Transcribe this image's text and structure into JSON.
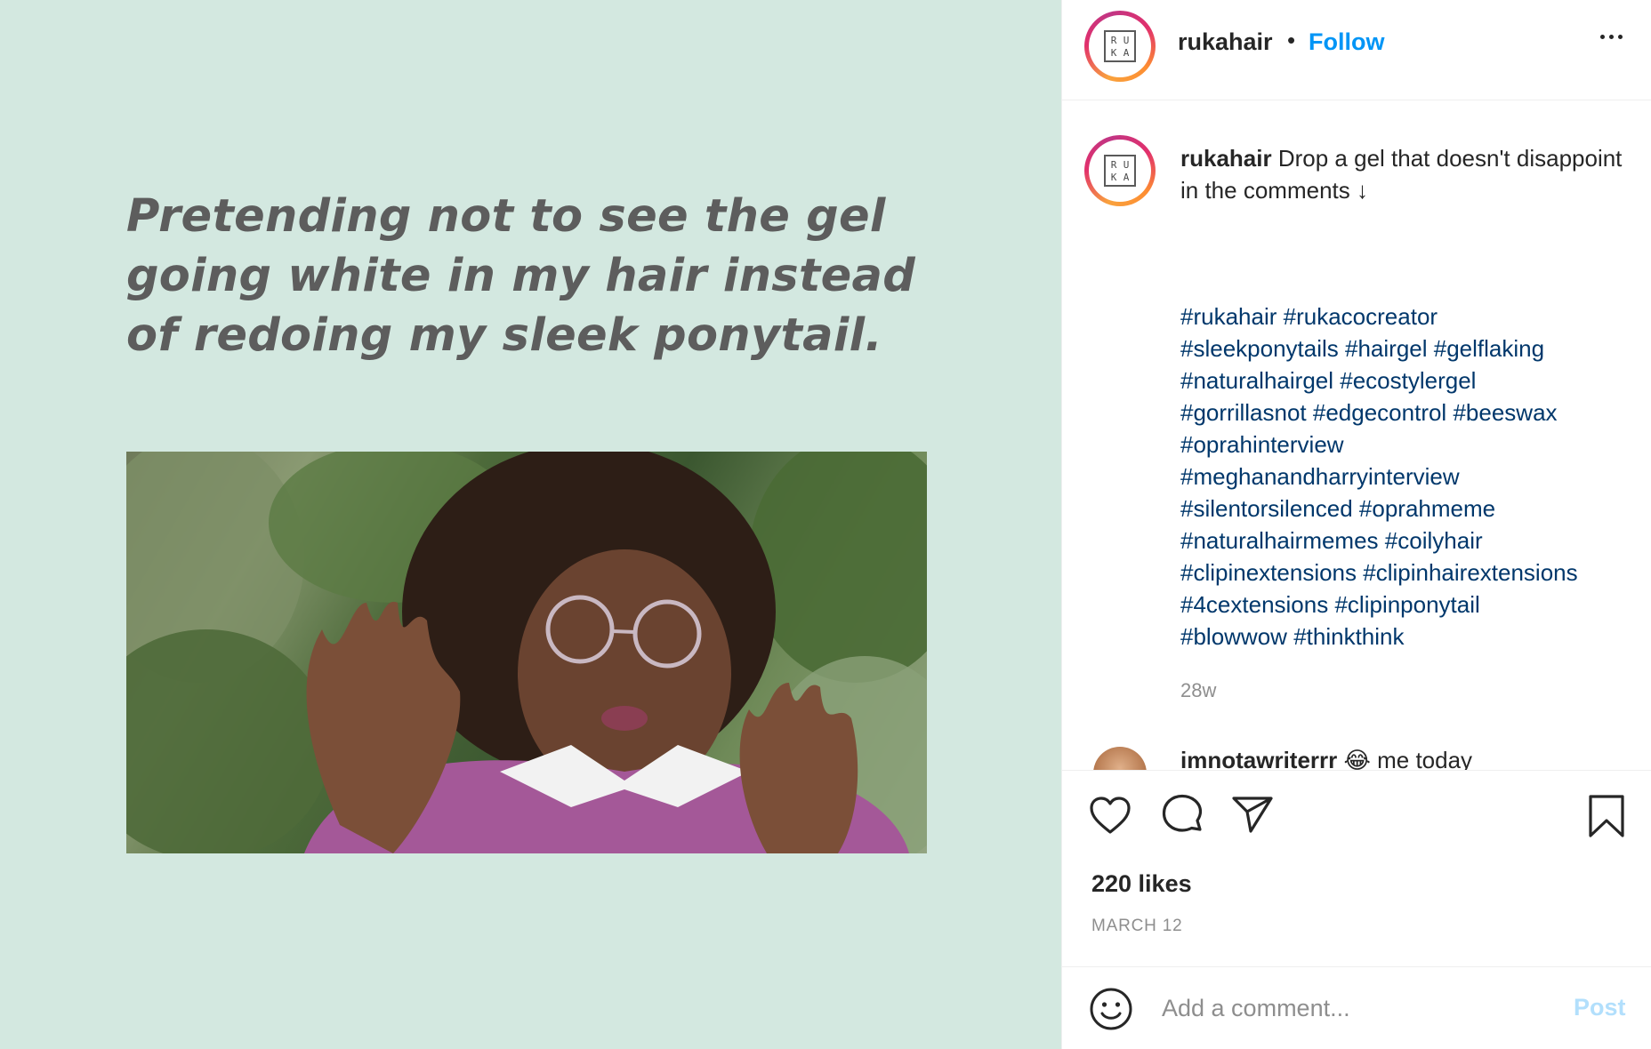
{
  "post": {
    "meme_text": "Pretending not to see the gel going white in my hair instead of redoing my sleek ponytail.",
    "media_bg": "#d3e8e0"
  },
  "header": {
    "username": "rukahair",
    "separator": "•",
    "follow_label": "Follow",
    "more_icon": "more-horizontal-icon"
  },
  "logo": {
    "letters": [
      "R",
      "U",
      "K",
      "A"
    ]
  },
  "caption": {
    "username": "rukahair",
    "text": "Drop a gel that doesn't disappoint in the comments ↓",
    "hashtags": [
      "#rukahair",
      "#rukacocreator",
      "#sleekponytails",
      "#hairgel",
      "#gelflaking",
      "#naturalhairgel",
      "#ecostylergel",
      "#gorrillasnot",
      "#edgecontrol",
      "#beeswax",
      "#oprahinterview",
      "#meghanandharryinterview",
      "#silentorsilenced",
      "#oprahmeme",
      "#naturalhairmemes",
      "#coilyhair",
      "#clipinextensions",
      "#clipinhairextensions",
      "#4cextensions",
      "#clipinponytail",
      "#blowwow",
      "#thinkthink"
    ],
    "age": "28w"
  },
  "next_comment": {
    "username": "imnotawriterrr",
    "text": "😂 me today"
  },
  "actions": {
    "like_icon": "heart-icon",
    "comment_icon": "comment-icon",
    "share_icon": "paper-plane-icon",
    "save_icon": "bookmark-icon",
    "likes": "220 likes",
    "date": "MARCH 12"
  },
  "add_comment": {
    "emoji_icon": "smiley-icon",
    "placeholder": "Add a comment...",
    "post_label": "Post"
  },
  "colors": {
    "link_blue": "#0095f6",
    "hashtag": "#00376b",
    "muted": "#8e8e8e",
    "post_disabled": "#b2dffc"
  }
}
